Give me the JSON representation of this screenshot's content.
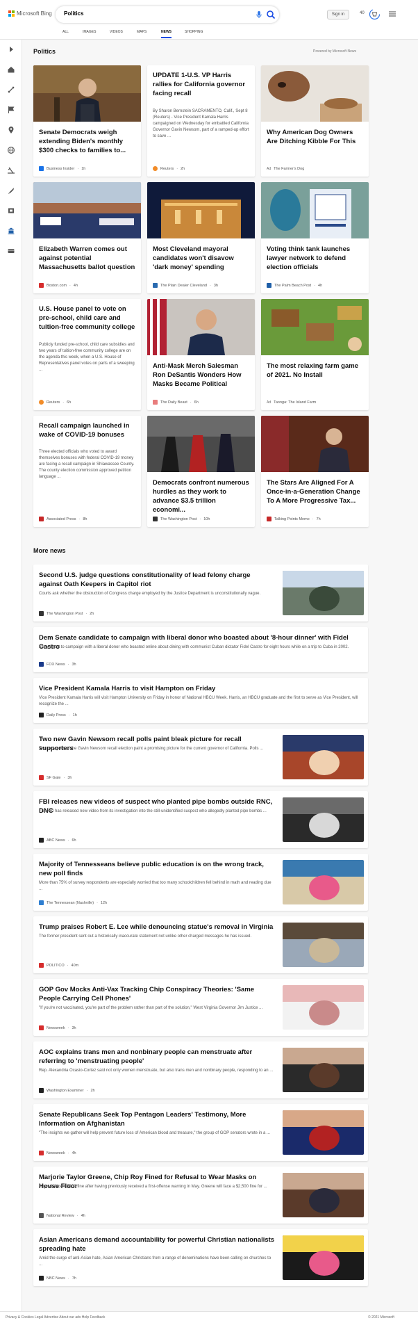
{
  "brand": {
    "name": "Microsoft Bing",
    "colors": [
      "#f25022",
      "#7fba00",
      "#00a4ef",
      "#ffb900"
    ]
  },
  "search": {
    "query": "Politics",
    "mic_icon": "mic-icon",
    "search_icon": "search-icon"
  },
  "header": {
    "sign_in": "Sign in",
    "points": "40",
    "reward_icon": "rewards-icon",
    "menu_icon": "hamburger-icon"
  },
  "tabs": [
    {
      "label": "ALL"
    },
    {
      "label": "IMAGES"
    },
    {
      "label": "VIDEOS"
    },
    {
      "label": "MAPS"
    },
    {
      "label": "NEWS"
    },
    {
      "label": "SHOPPING"
    }
  ],
  "active_tab": "NEWS",
  "accent": "#174ae4",
  "sidebar_icons": [
    "expand-icon",
    "home-icon",
    "sports-icon",
    "flag-icon",
    "location-icon",
    "globe-icon",
    "scales-icon",
    "rocket-icon",
    "film-icon",
    "bank-icon",
    "money-icon"
  ],
  "politics": {
    "heading": "Politics",
    "powered_by": "Powered by Microsoft News",
    "cards": [
      {
        "title": "Senate Democrats weigh extending Biden's monthly $300 checks to families to...",
        "source": "Business Insider",
        "time": "1h",
        "has_image": true,
        "fav": "#1a73e8"
      },
      {
        "title": "UPDATE 1-U.S. VP Harris rallies for California governor facing recall",
        "summary": "By Sharon Bernstein SACRAMENTO, Calif., Sept 8 (Reuters) - Vice President Kamala Harris campaigned on Wednesday for embattled California Governor Gavin Newsom, part of a ramped-up effort to save ...",
        "source": "Reuters",
        "time": "2h",
        "has_image": false,
        "fav": "#f28c28"
      },
      {
        "title": "Why American Dog Owners Are Ditching Kibble For This",
        "ad": "Ad",
        "source": "The Farmer's Dog",
        "time": "",
        "has_image": true,
        "fav": ""
      },
      {
        "title": "Elizabeth Warren comes out against potential Massachusetts ballot question",
        "source": "Boston.com",
        "time": "4h",
        "has_image": true,
        "fav": "#d62d2d"
      },
      {
        "title": "Most Cleveland mayoral candidates won't disavow 'dark money' spending",
        "source": "The Plain Dealer Cleveland",
        "time": "3h",
        "has_image": true,
        "fav": "#2a6bb0"
      },
      {
        "title": "Voting think tank launches lawyer network to defend election officials",
        "source": "The Palm Beach Post",
        "time": "4h",
        "has_image": true,
        "fav": "#1f5fa8"
      },
      {
        "title": "U.S. House panel to vote on pre-school, child care and tuition-free community college",
        "summary": "Publicly funded pre-school, child care subsidies and two years of tuition-free community college are on the agenda this week, when a U.S. House of Representatives panel votes on parts of a sweeping ...",
        "source": "Reuters",
        "time": "6h",
        "has_image": false,
        "fav": "#f28c28"
      },
      {
        "title": "Anti-Mask Merch Salesman Ron DeSantis Wonders How Masks Became Political",
        "source": "The Daily Beast",
        "time": "6h",
        "has_image": true,
        "fav": "#e87d7d"
      },
      {
        "title": "The most relaxing farm game of 2021. No Install",
        "ad": "Ad",
        "source": "Taonga: The Island Farm",
        "time": "",
        "has_image": true,
        "fav": ""
      },
      {
        "title": "Recall campaign launched in wake of COVID-19 bonuses",
        "summary": "Three elected officials who voted to award themselves bonuses with federal COVID-19 money are facing a recall campaign in Shiawassee County. The county election commission approved petition language ...",
        "source": "Associated Press",
        "time": "8h",
        "has_image": false,
        "fav": "#c62828"
      },
      {
        "title": "Democrats confront numerous hurdles as they work to advance $3.5 trillion economi...",
        "source": "The Washington Post",
        "time": "10h",
        "has_image": true,
        "fav": "#333333"
      },
      {
        "title": "The Stars Are Aligned For A Once-in-a-Generation Change To A More Progressive Tax...",
        "source": "Talking Points Memo",
        "time": "7h",
        "has_image": true,
        "fav": "#c62828"
      }
    ]
  },
  "more_news": {
    "heading": "More news",
    "items": [
      {
        "title": "Second U.S. judge questions constitutionality of lead felony charge against Oath Keepers in Capitol riot",
        "summary": "Courts ask whether the obstruction of Congress charge employed by the Justice Department is unconstitutionally vague.",
        "source": "The Washington Post",
        "time": "2h",
        "fav": "#333333",
        "has_image": true
      },
      {
        "title": "Dem Senate candidate to campaign with liberal donor who boasted about '8-hour dinner' with Fidel Castro",
        "summary": "Iowa, is set to campaign with a liberal donor who boasted online about dining with communist Cuban dictator Fidel Castro for eight hours while on a trip to Cuba in 2002.",
        "source": "FOX News",
        "time": "3h",
        "fav": "#1a3a8a",
        "has_image": false
      },
      {
        "title": "Vice President Kamala Harris to visit Hampton on Friday",
        "summary": "Vice President Kamala Harris will visit Hampton University on Friday in honor of National HBCU Week. Harris, an HBCU graduate and the first to serve as Vice President, will recognize the ...",
        "source": "Daily Press",
        "time": "1h",
        "fav": "#222222",
        "has_image": false
      },
      {
        "title": "Two new Gavin Newsom recall polls paint bleak picture for recall supporters",
        "summary": "Two new polls of the Gavin Newsom recall election paint a promising picture for the current governor of California. Polls ...",
        "source": "SF Gate",
        "time": "3h",
        "fav": "#d62d2d",
        "has_image": true
      },
      {
        "title": "FBI releases new videos of suspect who planted pipe bombs outside RNC, DNC",
        "summary": "The FBI has released new video from its investigation into the still-unidentified suspect who allegedly planted pipe bombs ...",
        "source": "ABC News",
        "time": "6h",
        "fav": "#222222",
        "has_image": true
      },
      {
        "title": "Majority of Tennesseans believe public education is on the wrong track, new poll finds",
        "summary": "More than 75% of survey respondents are especially worried that too many schoolchildren fell behind in math and reading due ...",
        "source": "The Tennessean (Nashville)",
        "time": "12h",
        "fav": "#2f7fd1",
        "has_image": true
      },
      {
        "title": "Trump praises Robert E. Lee while denouncing statue's removal in Virginia",
        "summary": "The former president sent out a historically inaccurate statement not unlike other charged messages he has issued.",
        "source": "POLITICO",
        "time": "40m",
        "fav": "#d62d2d",
        "has_image": true
      },
      {
        "title": "GOP Gov Mocks Anti-Vax Tracking Chip Conspiracy Theories: 'Same People Carrying Cell Phones'",
        "summary": "\"If you're not vaccinated, you're part of the problem rather than part of the solution,\" West Virginia Governor Jim Justice ...",
        "source": "Newsweek",
        "time": "3h",
        "fav": "#d62d2d",
        "has_image": true
      },
      {
        "title": "AOC explains trans men and nonbinary people can menstruate after referring to 'menstruating people'",
        "summary": "Rep. Alexandria Ocasio-Cortez said not only women menstruate, but also trans men and nonbinary people, responding to an ...",
        "source": "Washington Examiner",
        "time": "2h",
        "fav": "#222222",
        "has_image": true
      },
      {
        "title": "Senate Republicans Seek Top Pentagon Leaders' Testimony, More Information on Afghanistan",
        "summary": "\"The insights we gather will help prevent future loss of American blood and treasure,\" the group of GOP senators wrote in a ...",
        "source": "Newsweek",
        "time": "4h",
        "fav": "#d62d2d",
        "has_image": true
      },
      {
        "title": "Marjorie Taylor Greene, Chip Roy Fined for Refusal to Wear Masks on House Floor",
        "summary": "Roy will face a $500 fine after having previously received a first-offense warning in May. Greene will face a $2,500 fine for ...",
        "source": "National Review",
        "time": "4h",
        "fav": "#555555",
        "has_image": true
      },
      {
        "title": "Asian Americans demand accountability for powerful Christian nationalists spreading hate",
        "summary": "Amid the surge of anti-Asian hate, Asian American Christians from a range of denominations have been calling on churches to ...",
        "source": "NBC News",
        "time": "7h",
        "fav": "#222222",
        "has_image": true
      }
    ]
  },
  "footer": {
    "left": "Privacy & Cookies  Legal  Advertise  About our ads  Help  Feedback",
    "right": "© 2021 Microsoft"
  }
}
